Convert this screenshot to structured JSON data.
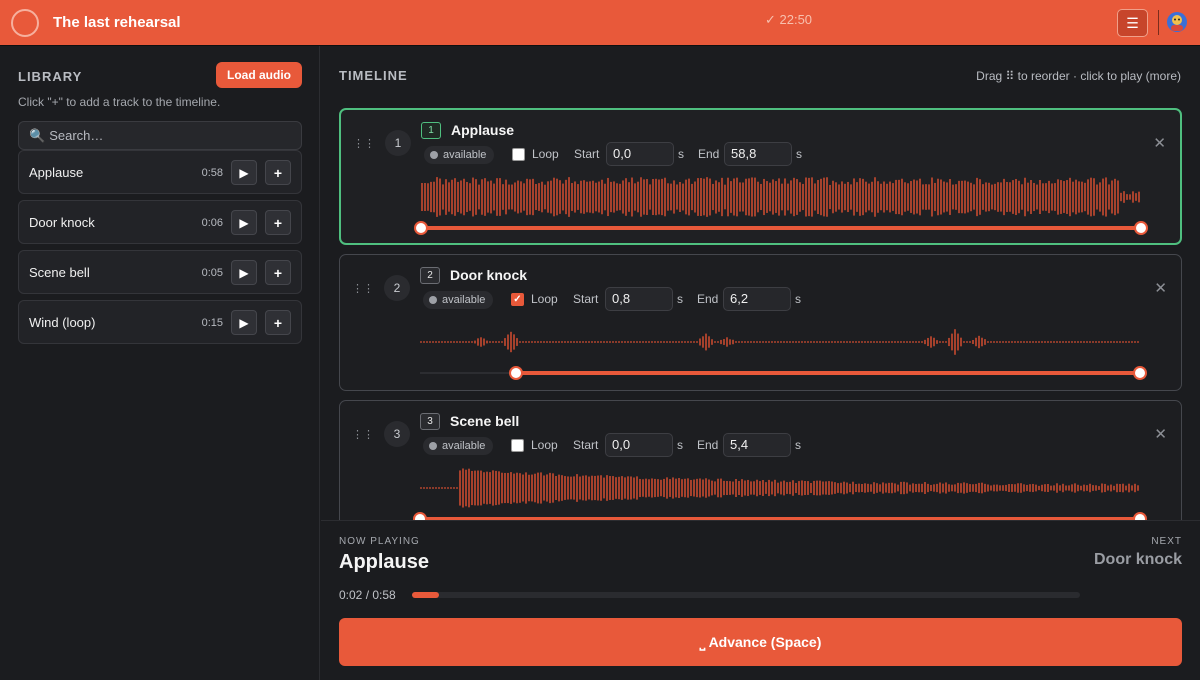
{
  "header": {
    "title": "The last rehearsal",
    "clock": "✓ 22:50",
    "menu_icon": "☰"
  },
  "library": {
    "title": "LIBRARY",
    "load_label": "Load audio",
    "hint": "Click \"+\" to add a track to the timeline.",
    "search_placeholder": "Search…",
    "items": [
      {
        "name": "Applause",
        "duration": "0:58"
      },
      {
        "name": "Door knock",
        "duration": "0:06"
      },
      {
        "name": "Scene bell",
        "duration": "0:05"
      },
      {
        "name": "Wind (loop)",
        "duration": "0:15"
      }
    ]
  },
  "timeline": {
    "title": "TIMELINE",
    "hint": "Drag ⠿ to reorder · click to play (more)",
    "loop_label": "Loop",
    "start_label": "Start",
    "end_label": "End",
    "unit": "s",
    "status": "available",
    "cards": [
      {
        "index": "1",
        "name": "Applause",
        "loop": false,
        "start": "0,0",
        "end": "58,8",
        "active": true
      },
      {
        "index": "2",
        "name": "Door knock",
        "loop": true,
        "start": "0,8",
        "end": "6,2",
        "active": false
      },
      {
        "index": "3",
        "name": "Scene bell",
        "loop": false,
        "start": "0,0",
        "end": "5,4",
        "active": false
      }
    ]
  },
  "now_playing": {
    "label": "NOW PLAYING",
    "name": "Applause",
    "next_label": "NEXT",
    "next_name": "Door knock",
    "time": "0:02 / 0:58",
    "progress": 0.04,
    "advance_label": "⎵ Advance (Space)"
  },
  "colors": {
    "accent": "#e8593a",
    "active_border": "#4fbf7f",
    "background": "#1b1c1f"
  }
}
